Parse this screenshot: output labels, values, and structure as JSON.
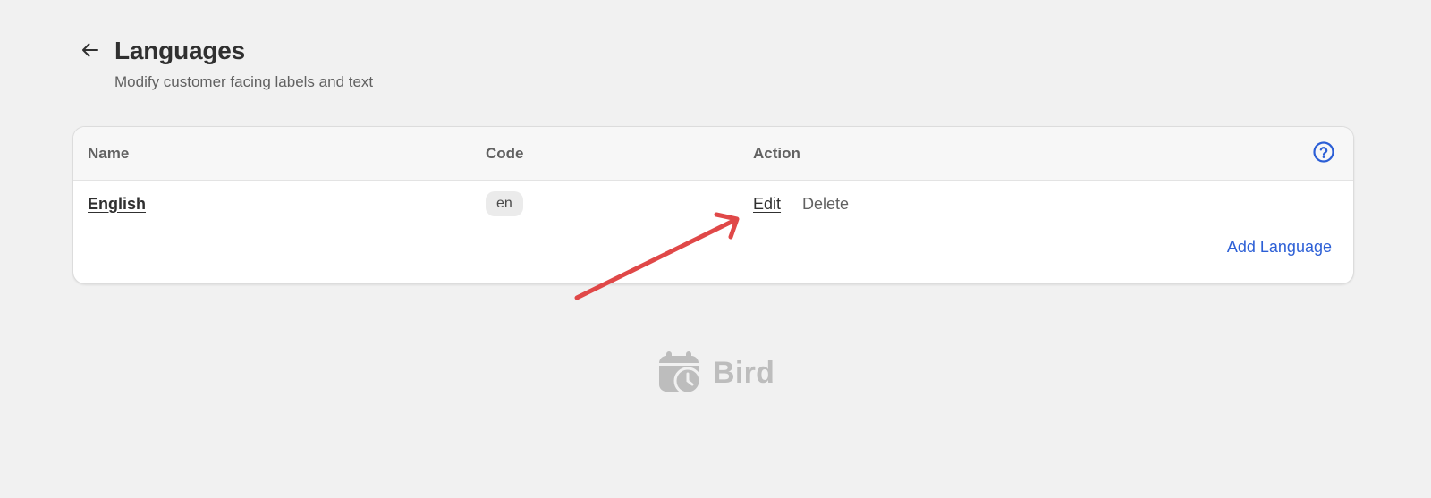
{
  "header": {
    "title": "Languages",
    "subtitle": "Modify customer facing labels and text"
  },
  "table": {
    "columns": [
      "Name",
      "Code",
      "Action"
    ],
    "rows": [
      {
        "name": "English",
        "code": "en",
        "actions": [
          "Edit",
          "Delete"
        ]
      }
    ],
    "add_button": "Add Language"
  },
  "icons": {
    "back": "arrow-left-icon",
    "help": "question-circle-icon",
    "watermark": "calendar-clock-icon"
  },
  "watermark": {
    "text": "Bird"
  },
  "colors": {
    "background": "#f1f1f1",
    "card": "#ffffff",
    "link_blue": "#2c5fd6",
    "annotation_arrow": "#e04848",
    "watermark_gray": "#9b9b9b"
  }
}
